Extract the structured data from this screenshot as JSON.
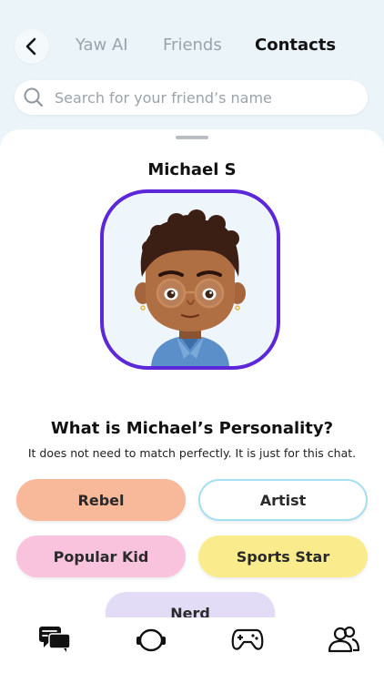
{
  "header": {
    "tabs": [
      {
        "label": "Yaw AI"
      },
      {
        "label": "Friends"
      },
      {
        "label": "Contacts"
      }
    ]
  },
  "search": {
    "placeholder": "Search for your friend’s name"
  },
  "contact": {
    "name": "Michael S"
  },
  "personality": {
    "question": "What is Michael’s Personality?",
    "subtext": "It does not need to match perfectly. It is just for this chat.",
    "options": [
      {
        "label": "Rebel",
        "color": "#f8b89a"
      },
      {
        "label": "Artist",
        "color": "#ffffff"
      },
      {
        "label": "Popular Kid",
        "color": "#fac3dd"
      },
      {
        "label": "Sports Star",
        "color": "#faec8d"
      },
      {
        "label": "Nerd",
        "color": "#e2dcf6"
      }
    ]
  },
  "colors": {
    "accent": "#5b27d8",
    "background": "#eaf4f9"
  },
  "bottom_nav": {
    "icons": [
      "chat-icon",
      "bot-icon",
      "gamepad-icon",
      "people-icon"
    ]
  }
}
